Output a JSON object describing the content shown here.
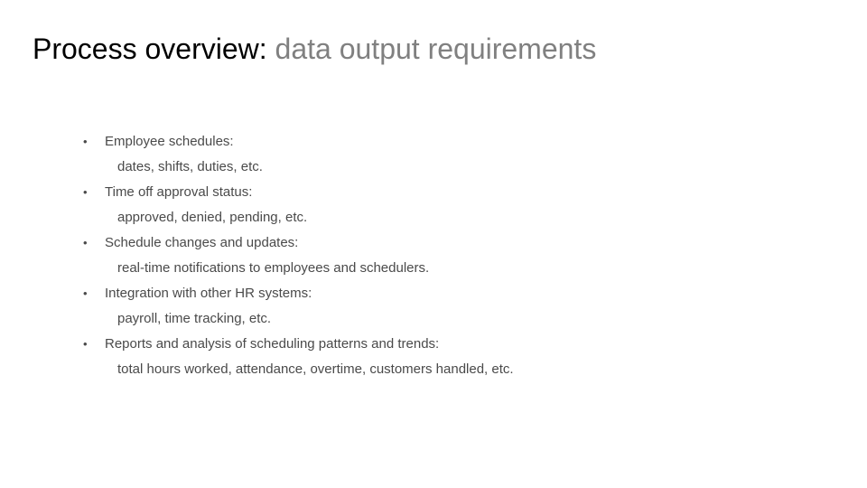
{
  "slide": {
    "title_lead": "Process overview:",
    "title_rest": "data output requirements",
    "bullet_glyph": "•",
    "items": [
      {
        "heading": "Employee schedules:",
        "detail": "dates, shifts, duties, etc."
      },
      {
        "heading": "Time off approval status:",
        "detail": "approved, denied, pending, etc."
      },
      {
        "heading": "Schedule changes and updates:",
        "detail": "real-time notifications to employees and schedulers."
      },
      {
        "heading": "Integration with other HR systems:",
        "detail": "payroll, time tracking, etc."
      },
      {
        "heading": "Reports and analysis of scheduling patterns and trends:",
        "detail": "total hours worked, attendance, overtime, customers handled, etc."
      }
    ]
  },
  "colors": {
    "title_lead": "#000000",
    "title_rest": "#808080",
    "body_text": "#4a4a4a",
    "background": "#ffffff"
  }
}
